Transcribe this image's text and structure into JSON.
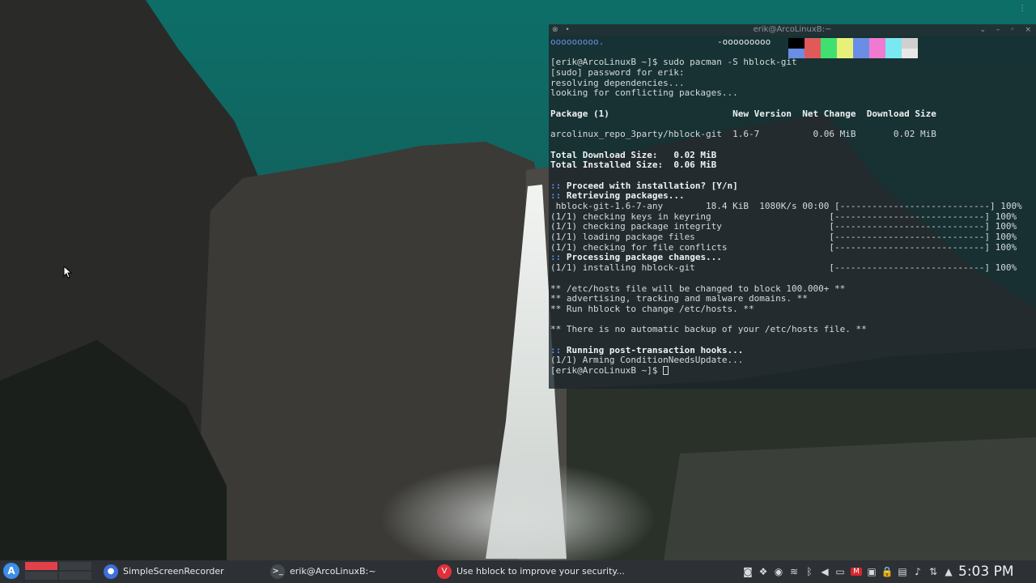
{
  "terminal": {
    "title": "erik@ArcoLinuxB:~",
    "neofetch_left": "ooooooooo.",
    "neofetch_right": "-ooooooooo",
    "palette_colors": [
      "#000000",
      "#e05a5a",
      "#40e070",
      "#e8f07a",
      "#6a8ee6",
      "#f07ad0",
      "#7ae8f0",
      "#d0d0d0",
      "#6a8ee6",
      "#e05a5a",
      "#40e070",
      "#e8f07a",
      "#6a8ee6",
      "#f07ad0",
      "#7ae8f0",
      "#e8e8e8"
    ],
    "lines": [
      {
        "text": ""
      },
      {
        "text": "[erik@ArcoLinuxB ~]$ sudo pacman -S hblock-git"
      },
      {
        "text": "[sudo] password for erik:"
      },
      {
        "text": "resolving dependencies..."
      },
      {
        "text": "looking for conflicting packages..."
      },
      {
        "text": ""
      },
      {
        "text": "Package (1)                       New Version  Net Change  Download Size",
        "style": "bold"
      },
      {
        "text": ""
      },
      {
        "text": "arcolinux_repo_3party/hblock-git  1.6-7          0.06 MiB       0.02 MiB"
      },
      {
        "text": ""
      },
      {
        "text": "Total Download Size:   0.02 MiB",
        "style": "bold"
      },
      {
        "text": "Total Installed Size:  0.06 MiB",
        "style": "bold"
      },
      {
        "text": ""
      },
      {
        "prefix": ":: ",
        "text": "Proceed with installation? [Y/n]",
        "style": "bold"
      },
      {
        "prefix": ":: ",
        "text": "Retrieving packages...",
        "style": "bold"
      },
      {
        "text": " hblock-git-1.6-7-any        18.4 KiB  1080K/s 00:00 [----------------------------] 100%"
      },
      {
        "text": "(1/1) checking keys in keyring                      [----------------------------] 100%"
      },
      {
        "text": "(1/1) checking package integrity                    [----------------------------] 100%"
      },
      {
        "text": "(1/1) loading package files                         [----------------------------] 100%"
      },
      {
        "text": "(1/1) checking for file conflicts                   [----------------------------] 100%"
      },
      {
        "prefix": ":: ",
        "text": "Processing package changes...",
        "style": "bold"
      },
      {
        "text": "(1/1) installing hblock-git                         [----------------------------] 100%"
      },
      {
        "text": ""
      },
      {
        "text": "** /etc/hosts file will be changed to block 100.000+ **"
      },
      {
        "text": "** advertising, tracking and malware domains. **"
      },
      {
        "text": "** Run hblock to change /etc/hosts. **"
      },
      {
        "text": ""
      },
      {
        "text": "** There is no automatic backup of your /etc/hosts file. **"
      },
      {
        "text": ""
      },
      {
        "prefix": ":: ",
        "text": "Running post-transaction hooks...",
        "style": "bold"
      },
      {
        "text": "(1/1) Arming ConditionNeedsUpdate..."
      },
      {
        "text": "[erik@ArcoLinuxB ~]$ ",
        "cursor": true
      }
    ]
  },
  "taskbar": {
    "launcher_glyph": "A",
    "tasks": [
      {
        "label": "SimpleScreenRecorder",
        "icon": "screen-recorder-icon",
        "color": "#3f6fd8",
        "glyph": "●"
      },
      {
        "label": "erik@ArcoLinuxB:~",
        "icon": "terminal-icon",
        "color": "#444a50",
        "glyph": ">_"
      },
      {
        "label": "Use hblock to improve your security...",
        "icon": "vivaldi-icon",
        "color": "#e0303a",
        "glyph": "V"
      }
    ],
    "tray_icons": [
      "discord-icon",
      "dropbox-icon",
      "chat-icon",
      "network-icon",
      "bluetooth-icon",
      "volume-icon",
      "battery-icon",
      "mega-icon",
      "kde-connect-icon",
      "lock-icon",
      "clipboard-icon",
      "speaker-icon",
      "updates-icon",
      "expand-tray-icon"
    ],
    "clock": "5:03 PM"
  },
  "colors": {
    "accent": "#3d8ee8",
    "terminal_blue": "#5b8ef0",
    "pager_active": "#e0404a"
  }
}
